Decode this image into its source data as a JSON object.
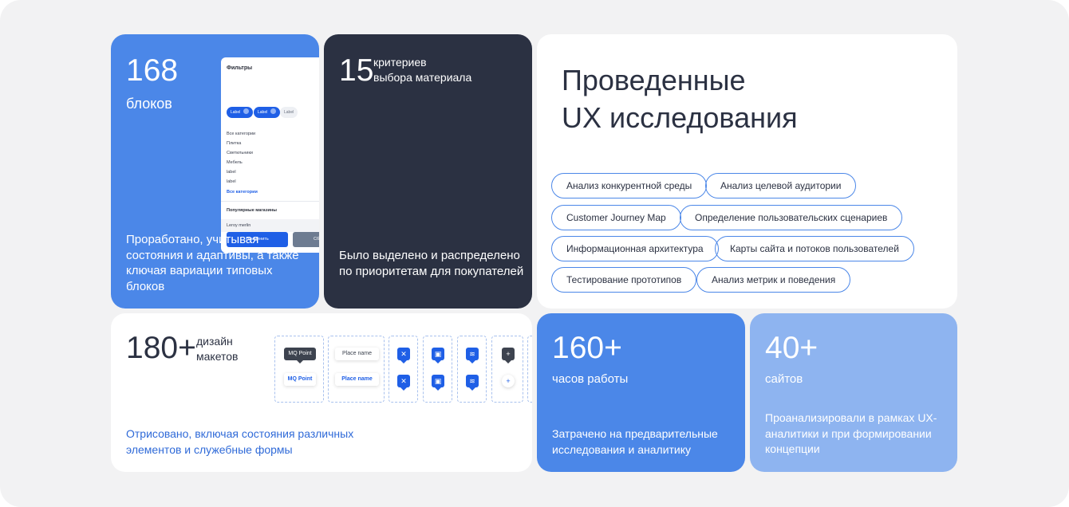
{
  "blocks_card": {
    "number": "168",
    "unit": "блоков",
    "description": "Проработано, учитывая состояния и адаптивы, а также ключая вариации типовых блоков",
    "filters_preview": {
      "title": "Фильтры",
      "chips": [
        "Label",
        "Label",
        "Label"
      ],
      "categories": [
        "Все категории",
        "Плитка",
        "Светильники",
        "Мебель",
        "label",
        "label"
      ],
      "all_categories_link": "Все категории",
      "popular_shops": "Популярные магазины",
      "shop": "Leroy merlin",
      "apply": "Применить",
      "reset": "Сбросить"
    }
  },
  "criteria_card": {
    "number": "15",
    "subtitle_line1": "критериев",
    "subtitle_line2": "выбора материала",
    "description": "Было выделено и распределено по приоритетам для покупателей"
  },
  "ux_card": {
    "title_line1": "Проведенные",
    "title_line2": "UX исследования",
    "tags": [
      "Анализ конкурентной среды",
      "Анализ целевой аудитории",
      "Customer Journey Map",
      "Определение пользовательских сценариев",
      "Информационная архитектура",
      "Карты сайта и потоков пользователей",
      "Тестирование прототипов",
      "Анализ метрик и поведения"
    ]
  },
  "designs_card": {
    "number": "180+",
    "subtitle_line1": "дизайн",
    "subtitle_line2": "макетов",
    "description": "Отрисовано, включая состояния различных элементов и служебные формы",
    "components": {
      "mq_point": "MQ Point",
      "place_name": "Place name"
    }
  },
  "hours_card": {
    "number": "160+",
    "unit": "часов работы",
    "description": "Затрачено на предварительные исследования и аналитику"
  },
  "sites_card": {
    "number": "40+",
    "unit": "сайтов",
    "description": "Проанализировали в рамках UX-аналитики и при формировании концепции"
  },
  "colors": {
    "background": "#f2f2f3",
    "primary_blue": "#4b87e8",
    "dark_card": "#2b3142",
    "light_blue": "#8eb4f0",
    "accent": "#1f5fe6"
  }
}
